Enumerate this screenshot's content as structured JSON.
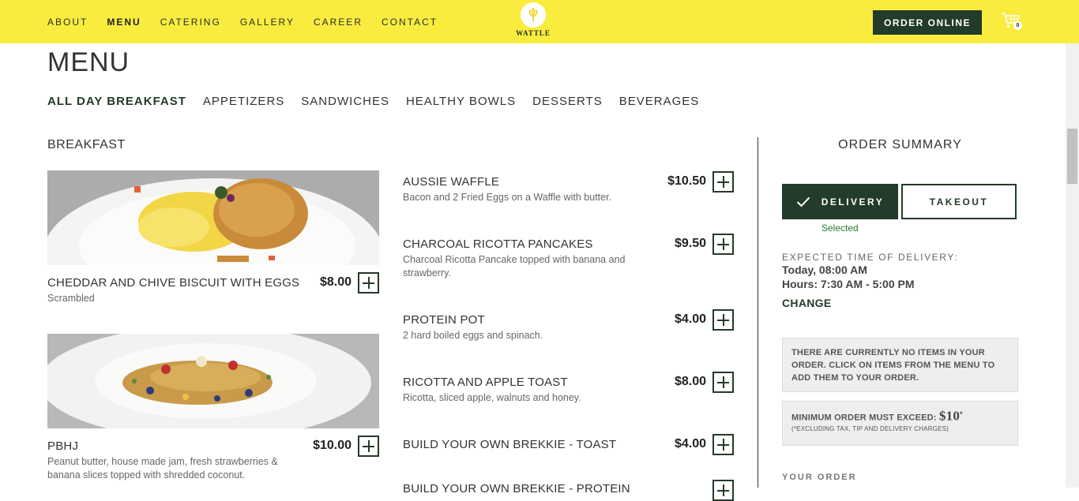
{
  "nav": {
    "items": [
      {
        "label": "ABOUT"
      },
      {
        "label": "MENU"
      },
      {
        "label": "CATERING"
      },
      {
        "label": "GALLERY"
      },
      {
        "label": "CAREER"
      },
      {
        "label": "CONTACT"
      }
    ],
    "active": "MENU",
    "logo_text": "WATTLE",
    "order_button": "ORDER ONLINE",
    "cart_count": "0"
  },
  "page_title": "MENU",
  "categories": [
    {
      "label": "ALL DAY BREAKFAST"
    },
    {
      "label": "APPETIZERS"
    },
    {
      "label": "SANDWICHES"
    },
    {
      "label": "HEALTHY BOWLS"
    },
    {
      "label": "DESSERTS"
    },
    {
      "label": "BEVERAGES"
    }
  ],
  "active_category": "ALL DAY BREAKFAST",
  "section_title": "BREAKFAST",
  "featured": [
    {
      "name": "CHEDDAR AND CHIVE BISCUIT WITH EGGS",
      "desc": "Scrambled",
      "price": "$8.00"
    },
    {
      "name": "PBHJ",
      "desc": "Peanut butter, house made jam, fresh strawberries & banana slices topped with shredded coconut.",
      "price": "$10.00"
    }
  ],
  "items": [
    {
      "name": "AUSSIE WAFFLE",
      "desc": "Bacon and 2 Fried Eggs on a Waffle with butter.",
      "price": "$10.50"
    },
    {
      "name": "CHARCOAL RICOTTA PANCAKES",
      "desc": "Charcoal Ricotta Pancake topped with banana and strawberry.",
      "price": "$9.50"
    },
    {
      "name": "PROTEIN POT",
      "desc": "2 hard boiled eggs and spinach.",
      "price": "$4.00"
    },
    {
      "name": "RICOTTA AND APPLE TOAST",
      "desc": "Ricotta, sliced apple, walnuts and honey.",
      "price": "$8.00"
    },
    {
      "name": "BUILD YOUR OWN BREKKIE - TOAST",
      "desc": "",
      "price": "$4.00"
    },
    {
      "name": "BUILD YOUR OWN BREKKIE - PROTEIN",
      "desc": "",
      "price": ""
    }
  ],
  "summary": {
    "title": "ORDER SUMMARY",
    "delivery_label": "DELIVERY",
    "takeout_label": "TAKEOUT",
    "selected_text": "Selected",
    "expected_label": "EXPECTED TIME OF DELIVERY:",
    "expected_time": "Today, 08:00 AM",
    "hours": "Hours: 7:30 AM - 5:00 PM",
    "change_label": "CHANGE",
    "empty_msg": "THERE ARE CURRENTLY NO ITEMS IN YOUR ORDER. CLICK ON ITEMS FROM THE MENU TO ADD THEM TO YOUR ORDER.",
    "min_label": "MINIMUM ORDER MUST EXCEED:",
    "min_amount": "$10",
    "min_star": "*",
    "min_note": "(*EXCLUDING TAX, TIP AND DELIVERY CHARGES)",
    "your_order": "YOUR ORDER"
  },
  "colors": {
    "accent": "#233b29",
    "topbar": "#f9ec3f"
  },
  "icons": {
    "cart": "shopping-cart-icon",
    "check": "check-icon",
    "add": "plus-icon",
    "logo": "wattle-leaf-icon"
  }
}
